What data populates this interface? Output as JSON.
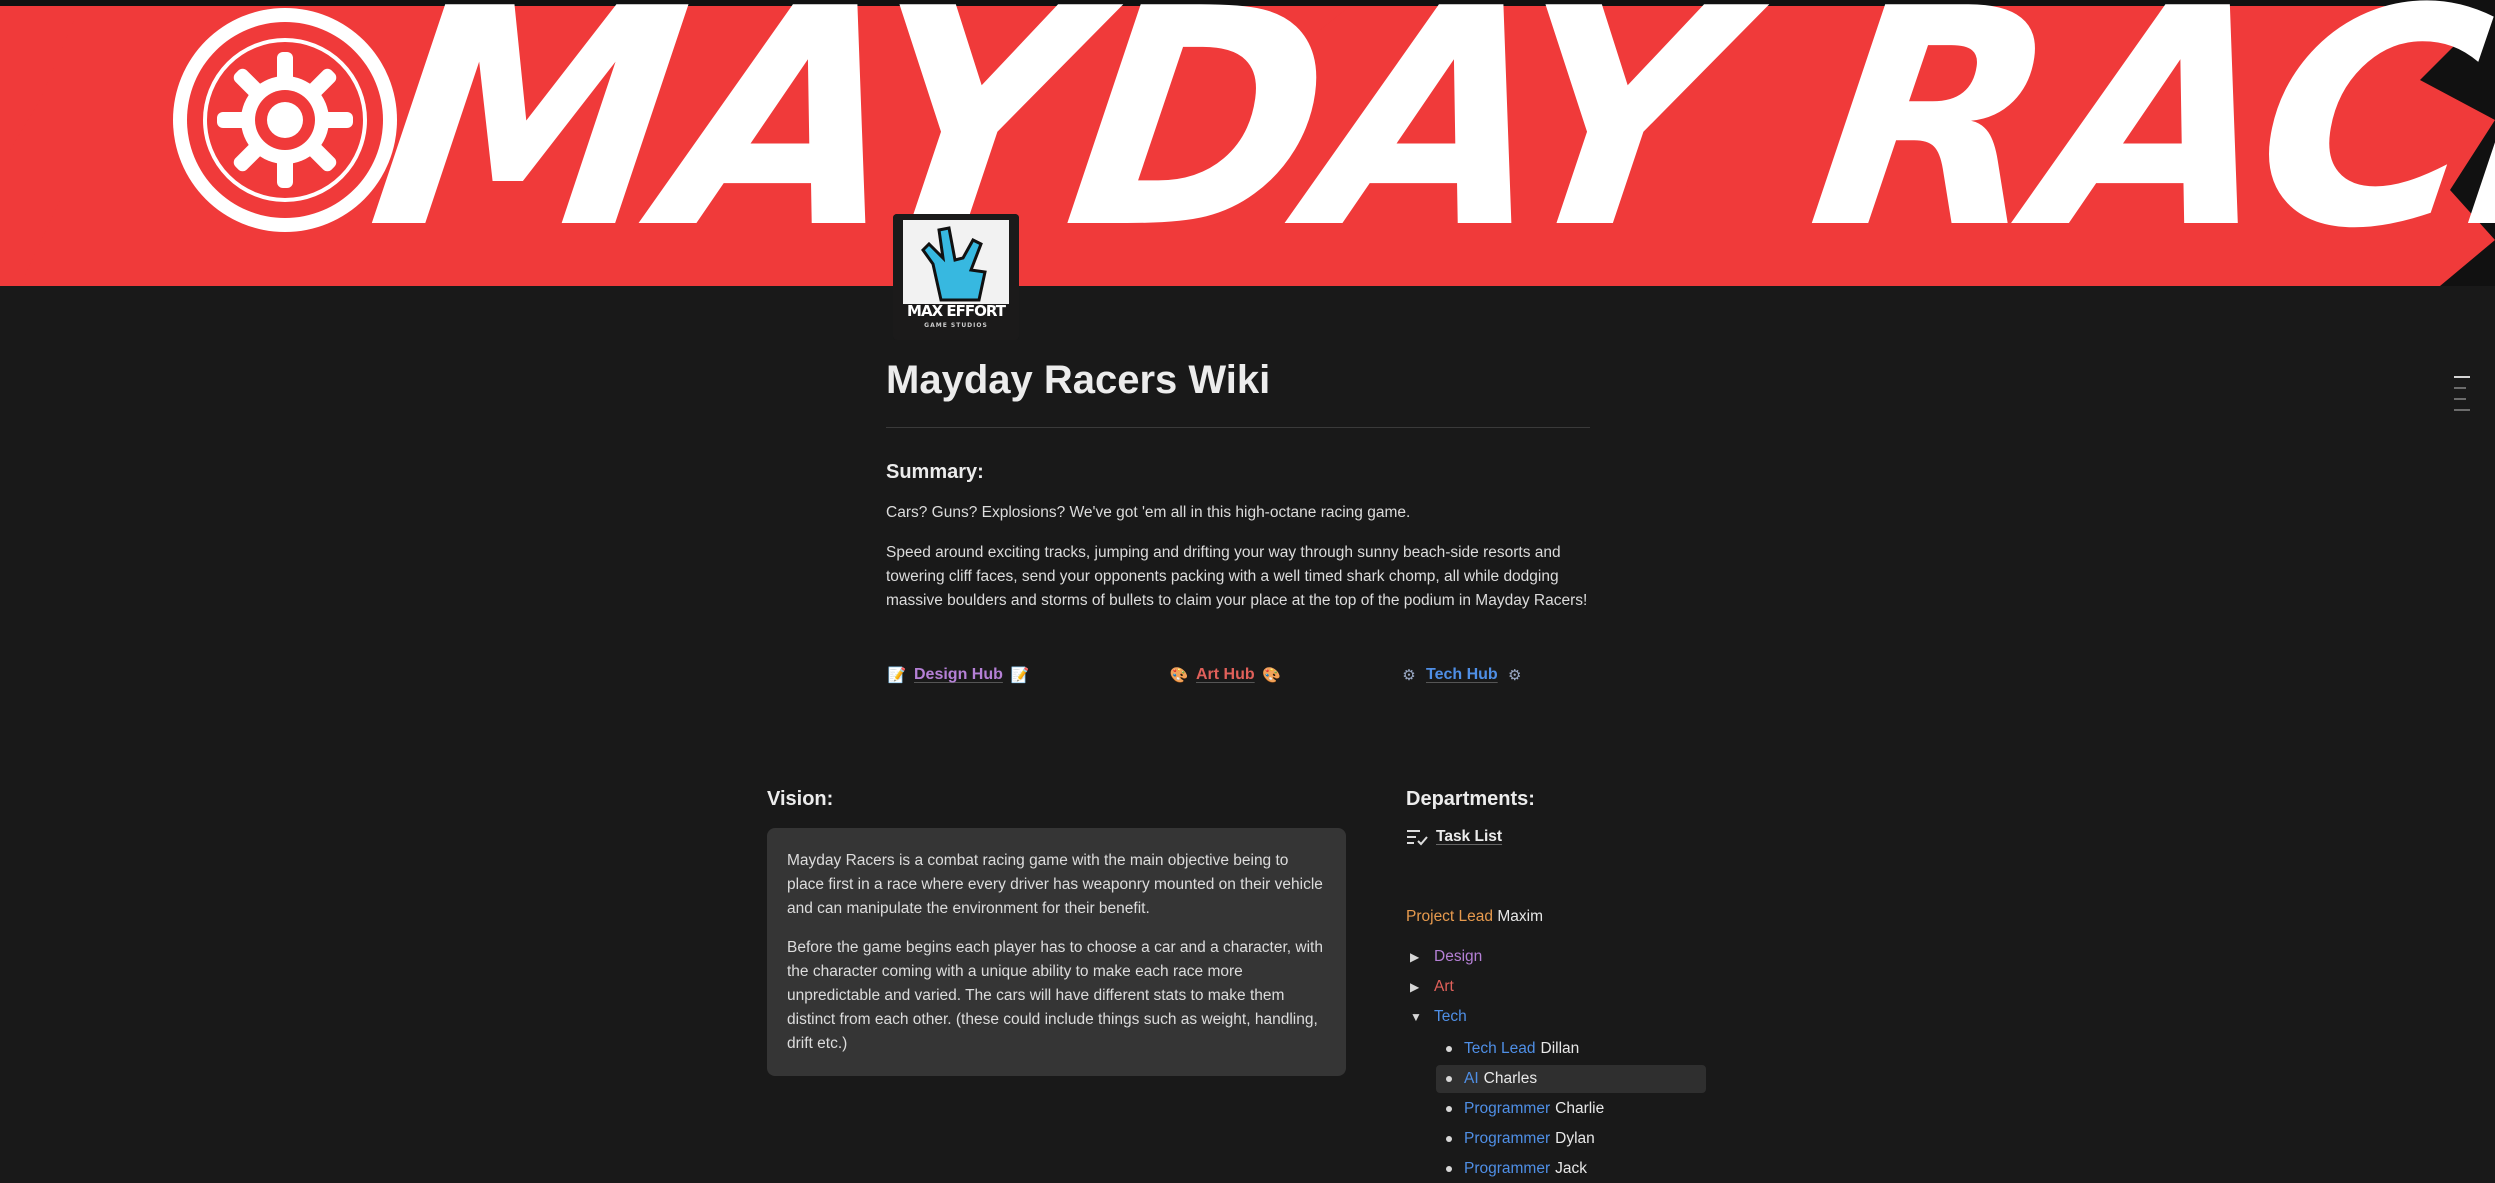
{
  "banner": {
    "text": "MAYDAY RACERS",
    "colors": {
      "red": "#f03a3a",
      "white": "#ffffff"
    }
  },
  "logo": {
    "line1": "MAX EFFORT",
    "line2": "GAME STUDIOS",
    "icon": "hand-icon"
  },
  "page": {
    "title": "Mayday Racers Wiki"
  },
  "summary": {
    "heading": "Summary:",
    "p1": "Cars? Guns? Explosions? We've got 'em all in this high-octane racing game.",
    "p2": "Speed around exciting tracks, jumping and drifting your way through sunny beach-side resorts and towering cliff faces, send your opponents packing with a well timed shark chomp, all while dodging massive boulders and storms of bullets to claim your place at the top of the podium in Mayday Racers!"
  },
  "hubs": [
    {
      "label": "Design Hub",
      "icon": "📝",
      "color": "#b580d6"
    },
    {
      "label": "Art Hub",
      "icon": "🎨",
      "color": "#e0605a"
    },
    {
      "label": "Tech Hub",
      "icon": "⚙",
      "color": "#4f8fe6"
    }
  ],
  "vision": {
    "heading": "Vision:",
    "p1": "Mayday Racers is a combat racing game with the main objective being to place first in a race where every driver has weaponry mounted on their vehicle and can manipulate the environment for their benefit.",
    "p2": "Before the game begins each player has to choose a car and a character, with the character coming with a unique ability to make each race more unpredictable and varied. The cars will have different stats to make them distinct from each other. (these could include things such as weight, handling, drift etc.)"
  },
  "departments": {
    "heading": "Departments:",
    "task_list": "Task List",
    "lead_role": "Project Lead",
    "lead_name": "Maxim",
    "groups": [
      {
        "label": "Design",
        "state": "▶"
      },
      {
        "label": "Art",
        "state": "▶"
      },
      {
        "label": "Tech",
        "state": "▼"
      }
    ],
    "tech_members": [
      {
        "role": "Tech Lead",
        "name": "Dillan"
      },
      {
        "role": "AI",
        "name": "Charles"
      },
      {
        "role": "Programmer",
        "name": "Charlie"
      },
      {
        "role": "Programmer",
        "name": "Dylan"
      },
      {
        "role": "Programmer",
        "name": "Jack"
      }
    ]
  }
}
